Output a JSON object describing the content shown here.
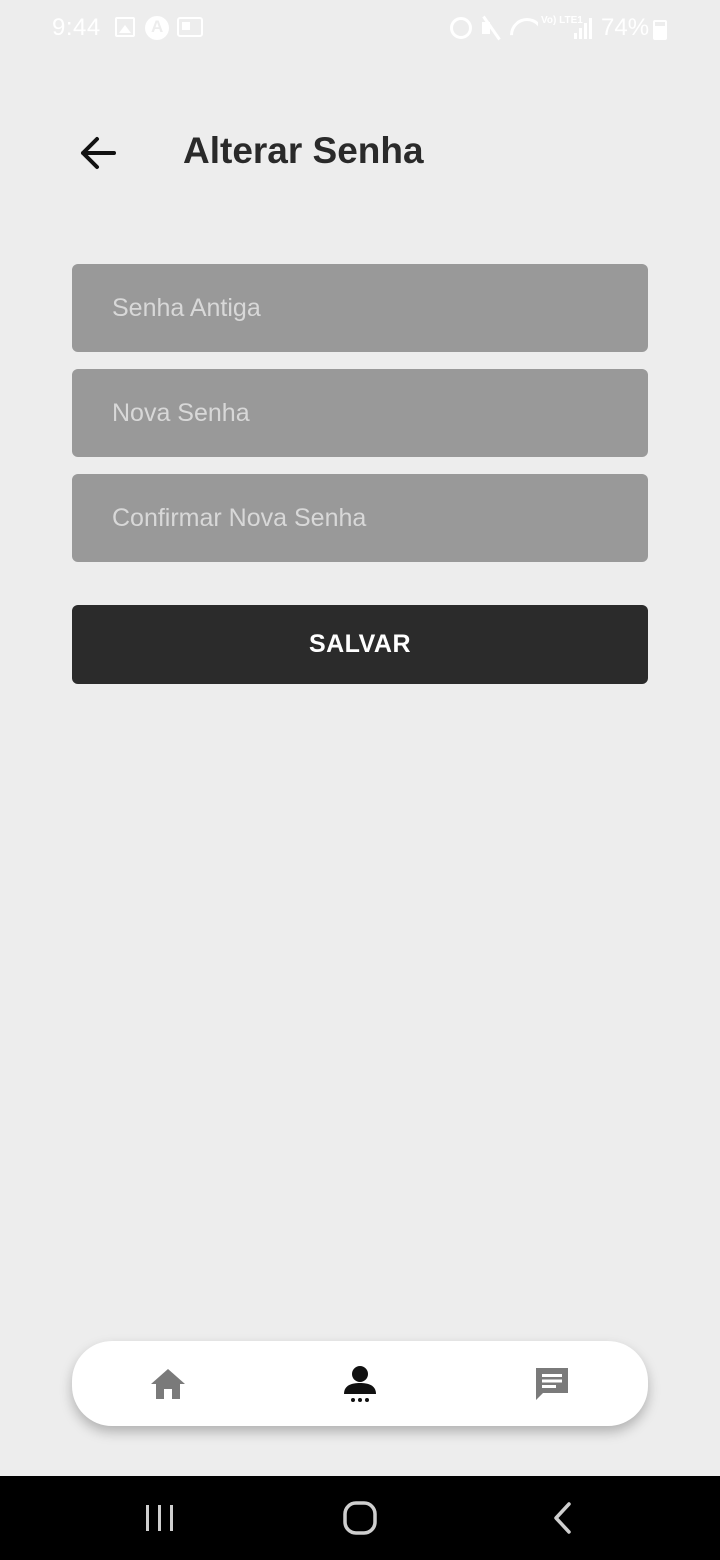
{
  "status_bar": {
    "time": "9:44",
    "battery": "74%",
    "network_label": "Vo) LTE1"
  },
  "header": {
    "title": "Alterar Senha",
    "back_icon": "arrow-left-icon"
  },
  "form": {
    "old_password": {
      "placeholder": "Senha Antiga",
      "value": ""
    },
    "new_password": {
      "placeholder": "Nova Senha",
      "value": ""
    },
    "confirm_password": {
      "placeholder": "Confirmar Nova Senha",
      "value": ""
    },
    "save_label": "SALVAR"
  },
  "tab_bar": {
    "tabs": [
      {
        "icon": "home-icon",
        "active": false
      },
      {
        "icon": "profile-icon",
        "active": true
      },
      {
        "icon": "message-icon",
        "active": false
      }
    ]
  },
  "system_nav": {
    "buttons": [
      "recents-icon",
      "home-circle-icon",
      "back-chevron-icon"
    ]
  },
  "colors": {
    "background": "#ededed",
    "field": "#999999",
    "button": "#2b2b2b",
    "title": "#2a2a2a",
    "icon_inactive": "#7a7a7a",
    "icon_active": "#111111"
  }
}
